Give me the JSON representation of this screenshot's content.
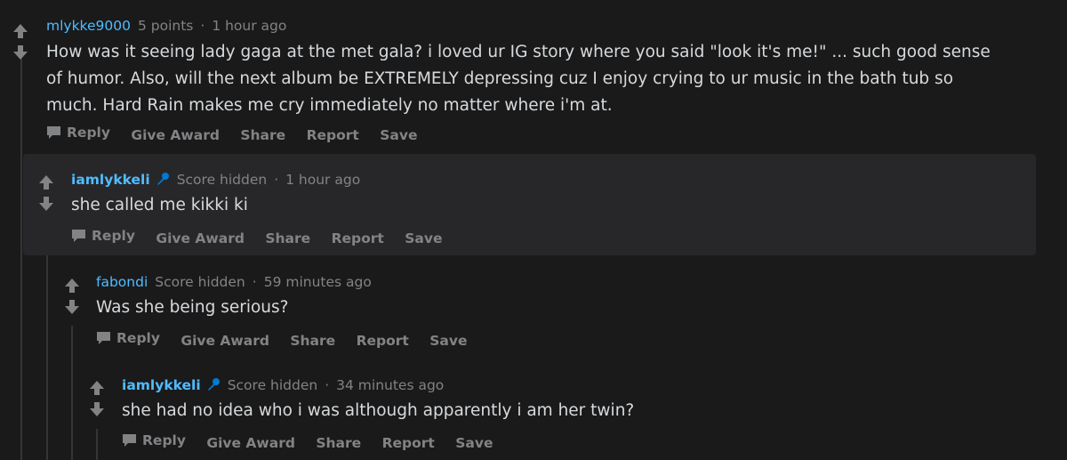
{
  "comments": [
    {
      "username": "mlykke9000",
      "score": "5 points",
      "separator": "·",
      "time": "1 hour ago",
      "body": "How was it seeing lady gaga at the met gala? i loved ur IG story where you said \"look it's me!\" ... such good sense of humor. Also, will the next album be EXTREMELY depressing cuz I enjoy crying to ur music in the bath tub so much. Hard Rain makes me cry immediately no matter where i'm at.",
      "actions": {
        "reply": "Reply",
        "award": "Give Award",
        "share": "Share",
        "report": "Report",
        "save": "Save"
      }
    },
    {
      "username": "iamlykkeli",
      "flair_icon": "microphone-icon",
      "score": "Score hidden",
      "separator": "·",
      "time": "1 hour ago",
      "body": "she called me kikki ki",
      "highlighted": true,
      "actions": {
        "reply": "Reply",
        "award": "Give Award",
        "share": "Share",
        "report": "Report",
        "save": "Save"
      }
    },
    {
      "username": "fabondi",
      "score": "Score hidden",
      "separator": "·",
      "time": "59 minutes ago",
      "body": "Was she being serious?",
      "actions": {
        "reply": "Reply",
        "award": "Give Award",
        "share": "Share",
        "report": "Report",
        "save": "Save"
      }
    },
    {
      "username": "iamlykkeli",
      "flair_icon": "microphone-icon",
      "score": "Score hidden",
      "separator": "·",
      "time": "34 minutes ago",
      "body": "she had no idea who i was although apparently i am her twin?",
      "actions": {
        "reply": "Reply",
        "award": "Give Award",
        "share": "Share",
        "report": "Report",
        "save": "Save"
      }
    }
  ],
  "colors": {
    "background": "#1a1a1b",
    "highlight": "#272729",
    "username": "#4fbcff",
    "muted": "#818384",
    "text": "#d7dadc",
    "mic": "#0079d3"
  }
}
